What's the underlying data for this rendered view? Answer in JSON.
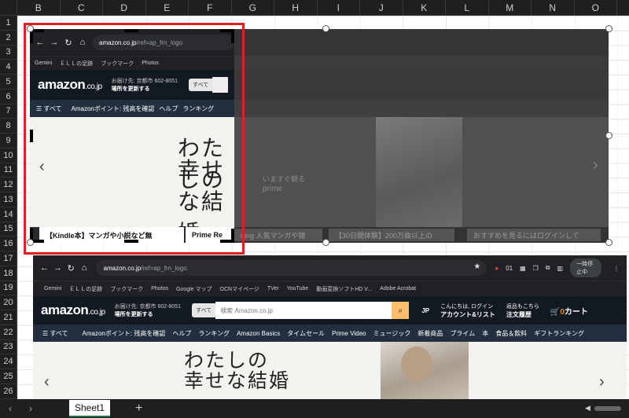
{
  "spreadsheet": {
    "columns": [
      "B",
      "C",
      "D",
      "E",
      "F",
      "G",
      "H",
      "I",
      "J",
      "K",
      "L",
      "M",
      "N",
      "O"
    ],
    "rows": [
      "1",
      "2",
      "3",
      "4",
      "5",
      "6",
      "7",
      "8",
      "9",
      "10",
      "11",
      "12",
      "13",
      "14",
      "15",
      "16",
      "17",
      "18",
      "19",
      "20",
      "21",
      "22",
      "23",
      "24",
      "25",
      "26"
    ],
    "sheet_tab": "Sheet1",
    "add_sheet": "+",
    "nav_prev": "‹",
    "nav_next": "›"
  },
  "browser": {
    "url_host": "amazon.co.jp",
    "url_path": "/ref=ap_frn_logo",
    "bookmarks": [
      "Gemini",
      "ＥＬＬの足跡",
      "ブックマーク",
      "Photos",
      "Google マップ",
      "OCNマイページ",
      "TVer",
      "YouTube",
      "動画変換ソフトHD V...",
      "Adobe Acrobat"
    ],
    "toolbar_badge": "01",
    "pause_label": "一時停止中"
  },
  "amazon": {
    "logo": "amazon",
    "logo_suffix": ".co.jp",
    "deliver_line1": "お届け先: 京都市 602-8051",
    "deliver_line2": "場所を更新する",
    "category": "すべて",
    "search_placeholder": "検索 Amazon.co.jp",
    "lang": "JP",
    "account_line1": "こんにちは, ログイン",
    "account_line2": "アカウント&リスト",
    "orders_line1": "返品もこちら",
    "orders_line2": "注文履歴",
    "cart_count": "0",
    "cart_label": "カート",
    "nav_items": [
      "すべて",
      "Amazonポイント: 残高を確認",
      "ヘルプ",
      "ランキング",
      "Amazon Basics",
      "タイムセール",
      "Prime Video",
      "ミュージック",
      "新着商品",
      "プライム",
      "本",
      "食品＆飲料",
      "ギフトランキング"
    ],
    "hero_line1": "わたしの",
    "hero_line2": "幸せな結婚",
    "cards": [
      "【Kindle本】マンガや小説など無",
      "Prime Re"
    ]
  },
  "faded": {
    "hero_sub": "いますぐ観る",
    "hero_brand": "prime",
    "cards": [
      "ding 人気マンガや雑",
      "【30日間体験】200万曲以上の",
      "おすすめを見るにはログインして"
    ]
  },
  "colors": {
    "selection": "#e0201f",
    "amazon_header": "#131921",
    "amazon_nav": "#232f3e",
    "search_button": "#febd69"
  }
}
